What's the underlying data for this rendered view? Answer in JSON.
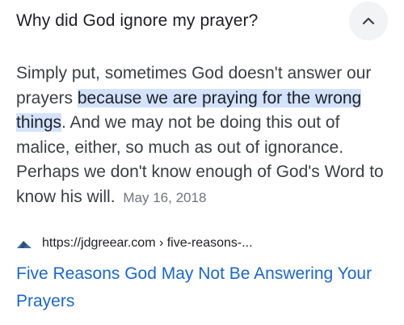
{
  "question": {
    "text": "Why did God ignore my prayer?",
    "toggle_icon": "chevron-up-icon"
  },
  "answer": {
    "before_highlight": "Simply put, sometimes God doesn't answer our prayers ",
    "highlight": "because we are praying for the wrong things",
    "after_highlight": ". And we may not be doing this out of malice, either, so much as out of ignorance. Perhaps we don't know enough of God's Word to know his will.",
    "date": "May 16, 2018"
  },
  "source": {
    "favicon": "site-favicon-icon",
    "url": "https://jdgreear.com › five-reasons-..."
  },
  "result": {
    "title": "Five Reasons God May Not Be Answering Your Prayers"
  },
  "colors": {
    "highlight": "#d3e3fd",
    "link": "#1967d2",
    "text": "#3c4043"
  }
}
